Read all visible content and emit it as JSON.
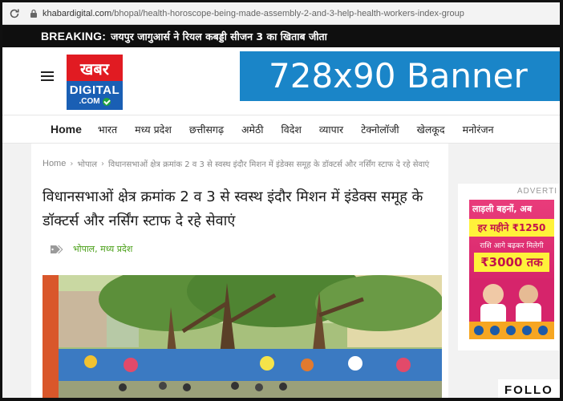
{
  "browser": {
    "url_domain": "khabardigital.com",
    "url_path": "/bhopal/health-horoscope-being-made-assembly-2-and-3-help-health-workers-index-group"
  },
  "breaking": {
    "label": "BREAKING:",
    "text": "जयपुर जागुआर्स ने रियल कबड्डी सीजन 3 का खिताब जीता"
  },
  "logo": {
    "top_text": "खबर",
    "digital_text": "DIGITAL",
    "com_text": ".COM"
  },
  "banner": {
    "text": "728x90 Banner"
  },
  "nav": {
    "items": [
      "Home",
      "भारत",
      "मध्य प्रदेश",
      "छत्तीसगढ़",
      "अमेठी",
      "विदेश",
      "व्यापार",
      "टेक्नोलॉजी",
      "खेलकूद",
      "मनोरंजन"
    ]
  },
  "breadcrumb": {
    "home": "Home",
    "category": "भोपाल",
    "current": "विधानसभाओं क्षेत्र क्रमांक 2 व 3 से स्वस्थ इंदौर मिशन में इंडेक्स समूह के डॉक्टर्स और नर्सिंग स्टाफ दे रहे सेवाएं"
  },
  "article": {
    "title": "विधानसभाओं क्षेत्र क्रमांक 2 व 3 से स्वस्थ इंदौर मिशन में इंडेक्स समूह के डॉक्टर्स और नर्सिंग स्टाफ दे रहे सेवाएं",
    "tags": "भोपाल, मध्य प्रदेश"
  },
  "sidebar": {
    "ad_label": "ADVERTI",
    "ad_line1": "लाड़ली बहनों, अब",
    "ad_line2": "हर महीने ₹1250",
    "ad_line3": "राशि आगे बढ़कर मिलेगी",
    "ad_line4": "₹3000 तक",
    "follow_label": "FOLLO"
  },
  "colors": {
    "accent_green": "#4aa018",
    "brand_red": "#e11b22",
    "brand_blue": "#1a5fb4",
    "banner_blue": "#1a85c8"
  }
}
